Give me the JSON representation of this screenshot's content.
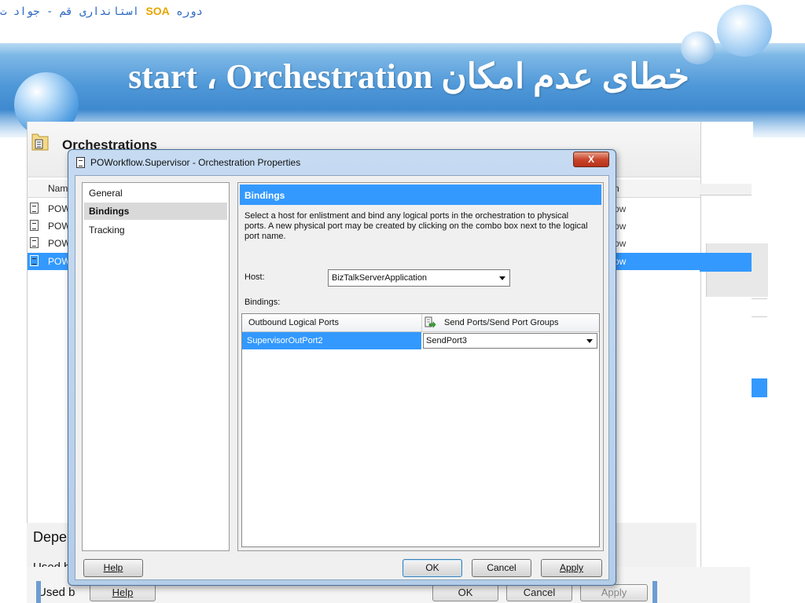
{
  "slide": {
    "ribbon_prefix": "دوره",
    "ribbon_soa": "SOA",
    "ribbon_suffix": "استانداری قم  -  جواد ت",
    "title": "خطای عدم امکان start ، Orchestration"
  },
  "background_window": {
    "title": "Orchestrations",
    "column_name": "Name",
    "column_right": "n",
    "rows": [
      {
        "name": "POW",
        "right": "ow",
        "selected": false
      },
      {
        "name": "POW",
        "right": "ow",
        "selected": false
      },
      {
        "name": "POW",
        "right": "ow",
        "selected": false
      },
      {
        "name": "POW",
        "right": "ow",
        "selected": true
      }
    ],
    "dependencies_title": "Depe",
    "used_by_1": "Used b",
    "used_by_2": "Used b",
    "help": "Help",
    "ok": "OK",
    "cancel": "Cancel",
    "apply": "Apply"
  },
  "dialog": {
    "title": "POWorkflow.Supervisor - Orchestration Properties",
    "close_label": "X",
    "nav": [
      {
        "label": "General",
        "selected": false
      },
      {
        "label": "Bindings",
        "selected": true
      },
      {
        "label": "Tracking",
        "selected": false
      }
    ],
    "section_header": "Bindings",
    "description": "Select a host for enlistment and bind any logical ports in the orchestration to physical ports. A new physical port may be created by clicking on the combo box next to the logical port name.",
    "host_label": "Host:",
    "host_value": "BizTalkServerApplication",
    "bindings_label": "Bindings:",
    "grid": {
      "col1": "Outbound Logical Ports",
      "col2": "Send Ports/Send Port Groups",
      "rows": [
        {
          "logical_port": "SupervisorOutPort2",
          "send_port": "SendPort3"
        }
      ]
    },
    "buttons": {
      "help": "Help",
      "ok": "OK",
      "cancel": "Cancel",
      "apply": "Apply"
    }
  },
  "colors": {
    "accent": "#3399ff",
    "band": "#4f98d8",
    "ribbon_text": "#2a66c4",
    "ribbon_soa": "#e8a400"
  }
}
